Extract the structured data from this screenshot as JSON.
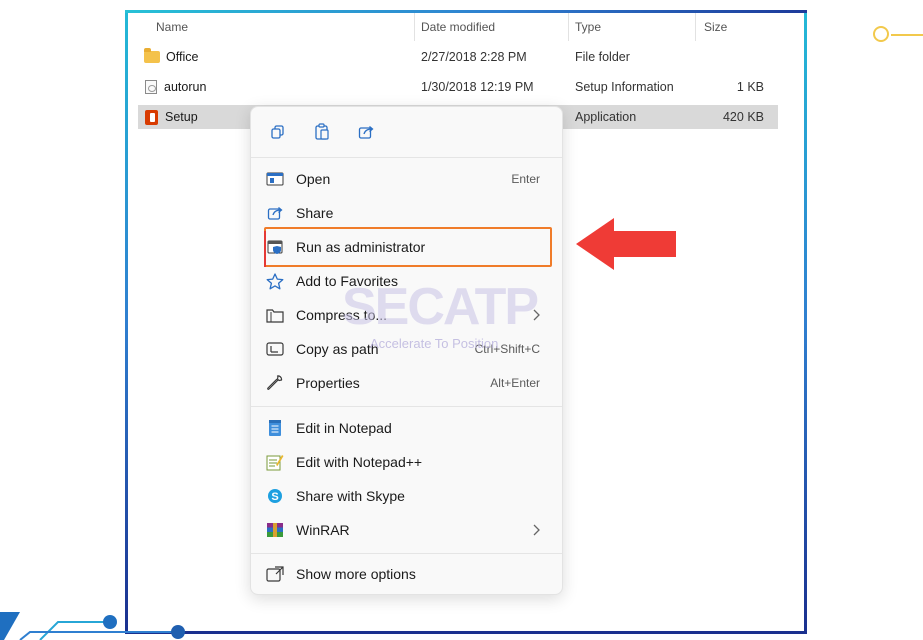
{
  "columns": {
    "name": "Name",
    "date": "Date modified",
    "type": "Type",
    "size": "Size"
  },
  "files": [
    {
      "name": "Office",
      "icon": "folder-icon",
      "date": "2/27/2018 2:28 PM",
      "type": "File folder",
      "size": ""
    },
    {
      "name": "autorun",
      "icon": "setup-info-icon",
      "date": "1/30/2018 12:19 PM",
      "type": "Setup Information",
      "size": "1 KB"
    },
    {
      "name": "Setup",
      "icon": "office-icon",
      "date": "",
      "type": "Application",
      "size": "420 KB",
      "selected": true
    }
  ],
  "context_menu": {
    "quick_actions": [
      {
        "name": "copy",
        "icon": "copy-icon"
      },
      {
        "name": "paste",
        "icon": "paste-icon"
      },
      {
        "name": "share",
        "icon": "share-icon"
      }
    ],
    "groups": [
      [
        {
          "label": "Open",
          "icon": "open-icon",
          "shortcut": "Enter"
        },
        {
          "label": "Share",
          "icon": "share-icon"
        },
        {
          "label": "Run as administrator",
          "icon": "shield-icon",
          "highlighted": true
        },
        {
          "label": "Add to Favorites",
          "icon": "star-icon"
        },
        {
          "label": "Compress to...",
          "icon": "zip-folder-icon",
          "submenu": true
        },
        {
          "label": "Copy as path",
          "icon": "path-icon",
          "shortcut": "Ctrl+Shift+C"
        },
        {
          "label": "Properties",
          "icon": "wrench-icon",
          "shortcut": "Alt+Enter"
        }
      ],
      [
        {
          "label": "Edit in Notepad",
          "icon": "notepad-icon"
        },
        {
          "label": "Edit with Notepad++",
          "icon": "notepadpp-icon"
        },
        {
          "label": "Share with Skype",
          "icon": "skype-icon"
        },
        {
          "label": "WinRAR",
          "icon": "winrar-icon",
          "submenu": true
        }
      ],
      [
        {
          "label": "Show more options",
          "icon": "more-options-icon"
        }
      ]
    ]
  },
  "watermark": {
    "brand": "SECATP",
    "tagline": "Accelerate To Position"
  },
  "colors": {
    "highlight_border": "#f07c2a",
    "arrow": "#ef3b36",
    "frame_top": "#27c1d6",
    "frame_bottom": "#1a2f8e",
    "selected_row": "#d9d9d9"
  }
}
